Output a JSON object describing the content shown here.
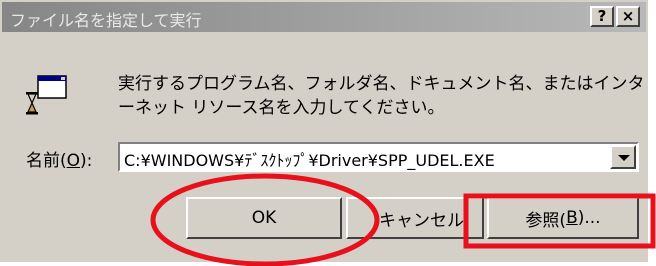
{
  "window": {
    "title": "ファイル名を指定して実行",
    "help_label": "?",
    "close_label": "×"
  },
  "prompt": {
    "line1": "実行するプログラム名、フォルダ名、ドキュメント名、またはインタ",
    "line2": "ーネット リソース名を入力してください。"
  },
  "name_field": {
    "label_prefix": "名前(",
    "label_accel": "O",
    "label_suffix": "):",
    "value": "C:¥WINDOWS¥ﾃﾞｽｸﾄｯﾌﾟ¥Driver¥SPP_UDEL.EXE"
  },
  "buttons": {
    "ok": "OK",
    "cancel": "キャンセル",
    "browse_prefix": "参照(",
    "browse_accel": "B",
    "browse_suffix": ")..."
  },
  "annotations": {
    "ellipse_color": "#e8101a",
    "rect_color": "#e8101a"
  }
}
